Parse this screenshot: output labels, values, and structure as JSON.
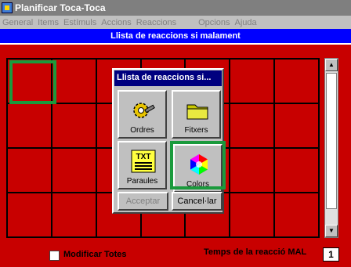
{
  "window": {
    "title": "Planificar Toca-Toca"
  },
  "menu": [
    "General",
    "Items",
    "Estímuls",
    "Accions",
    "Reaccions",
    "Opcions",
    "Ajuda"
  ],
  "banner": {
    "text": "Llista de reaccions si malament"
  },
  "dialog": {
    "title": "Llista de reaccions si...",
    "tiles": [
      {
        "label": "Ordres",
        "icon": "gear-wrench-icon"
      },
      {
        "label": "Fitxers",
        "icon": "folder-icon"
      },
      {
        "label": "Paraules",
        "icon": "txt-icon"
      },
      {
        "label": "Colors",
        "icon": "color-wheel-icon"
      }
    ],
    "accept_label": "Acceptar",
    "cancel_label": "Cancel·lar"
  },
  "footer": {
    "checkbox_label": "Modificar Totes",
    "temps_label": "Temps de la reacció MAL",
    "temps_value": "1"
  },
  "colors": {
    "background": "#c80000",
    "selection": "#1a9a3c",
    "banner": "#0000ff"
  }
}
